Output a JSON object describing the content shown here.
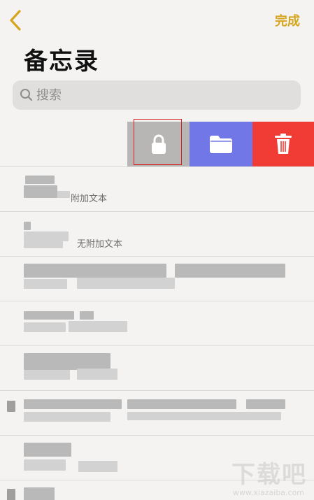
{
  "nav": {
    "done_label": "完成"
  },
  "page": {
    "title": "备忘录"
  },
  "search": {
    "placeholder": "搜索"
  },
  "notes": [
    {
      "subtitle": "附加文本"
    },
    {
      "subtitle": "无附加文本"
    }
  ],
  "swipe_actions": [
    "lock",
    "move-to-folder",
    "delete"
  ],
  "colors": {
    "accent": "#d6a520",
    "lock_action": "#b7b6b4",
    "folder_action": "#7177e6",
    "delete_action": "#f13b35",
    "highlight": "#d82020"
  },
  "watermark": {
    "brand": "下载吧",
    "url": "www.xiazaiba.com"
  }
}
